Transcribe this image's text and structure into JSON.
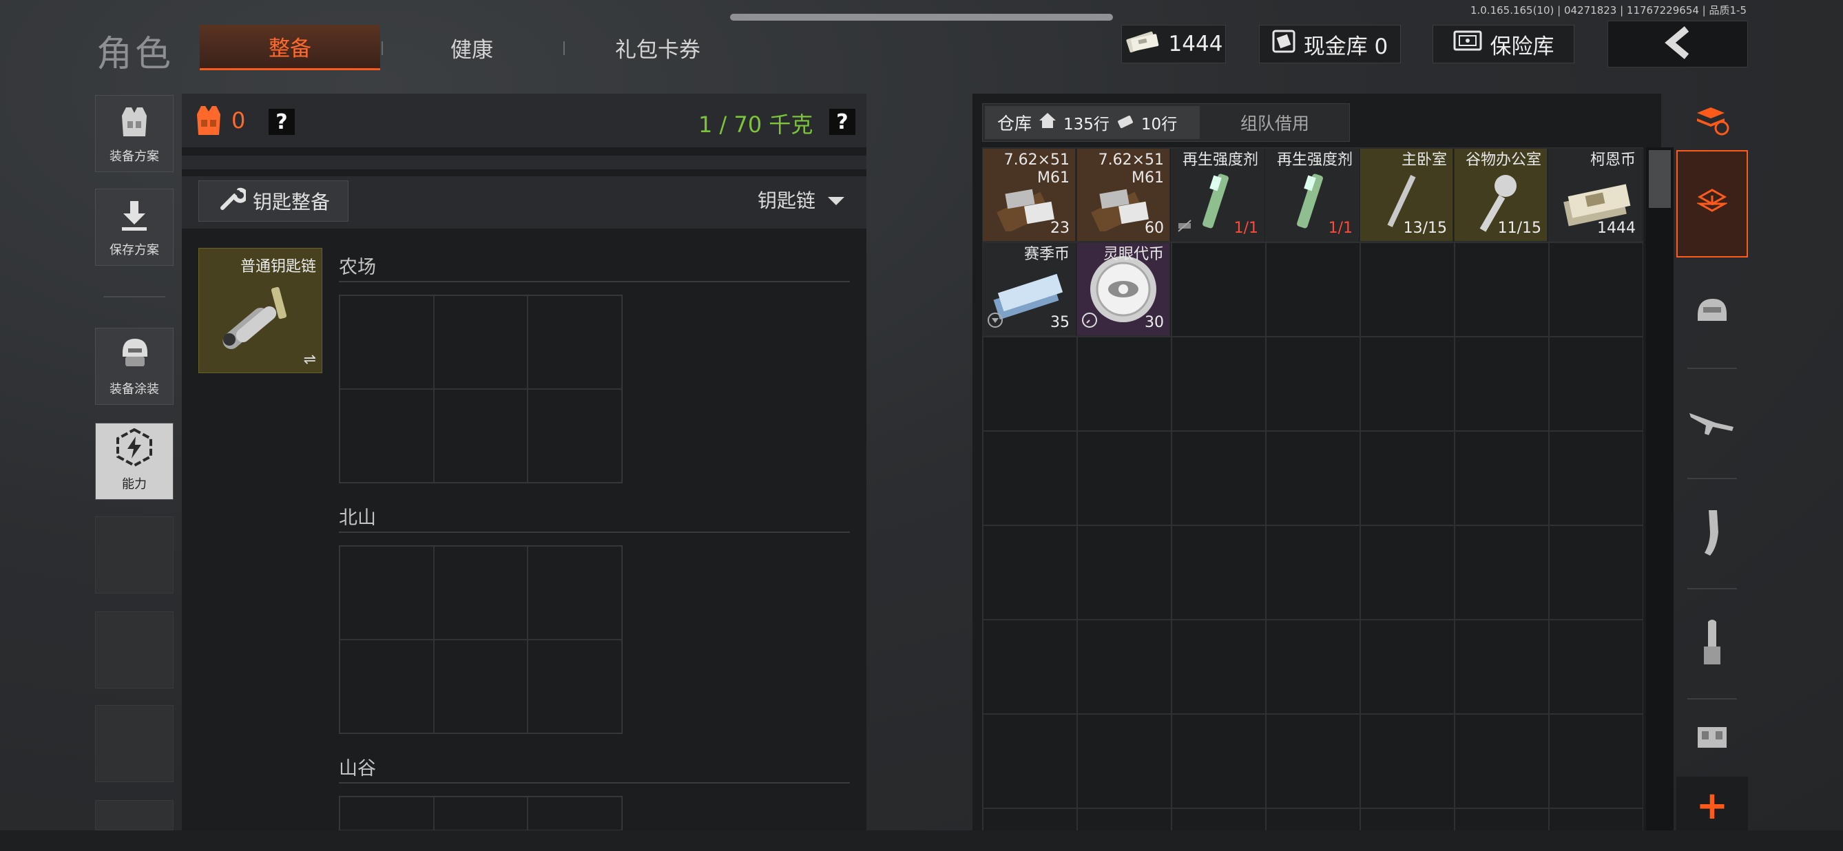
{
  "version_info": "1.0.165.165(10) | 04271823 | 11767229654 | 品质1-5",
  "header": {
    "page_title": "角色",
    "tabs": [
      "整备",
      "健康",
      "礼包卡券"
    ],
    "active_tab": "整备",
    "currency_amount": "1444",
    "cash_stash_label": "现金库 0",
    "safe_label": "保险库"
  },
  "sidebar": {
    "items": [
      {
        "label": "装备方案",
        "icon": "vest-icon"
      },
      {
        "label": "保存方案",
        "icon": "download-icon"
      },
      {
        "label": "装备涂装",
        "icon": "helmet-paint-icon"
      },
      {
        "label": "能力",
        "icon": "ability-bolt-icon"
      }
    ]
  },
  "loadout": {
    "armor_value": "0",
    "help_mark": "?",
    "weight": "1 / 70 千克",
    "key_button_label": "钥匙整备",
    "dropdown_label": "钥匙链",
    "key_item_name": "普通钥匙链",
    "sections": [
      "农场",
      "北山",
      "山谷"
    ]
  },
  "stash": {
    "tab_label": "仓库",
    "rows_label": "135行",
    "extra_rows_label": "10行",
    "team_borrow_label": "组队借用",
    "items": [
      {
        "name": "7.62×51\nM61",
        "count": "23",
        "count_red": false,
        "bg": "#4a3424"
      },
      {
        "name": "7.62×51\nM61",
        "count": "60",
        "count_red": false,
        "bg": "#4a3424"
      },
      {
        "name": "再生强度剂",
        "count": "1/1",
        "count_red": true,
        "bg": "#26282a"
      },
      {
        "name": "再生强度剂",
        "count": "1/1",
        "count_red": true,
        "bg": "#26282a"
      },
      {
        "name": "主卧室",
        "count": "13/15",
        "count_red": false,
        "bg": "#433d1f"
      },
      {
        "name": "谷物办公室",
        "count": "11/15",
        "count_red": false,
        "bg": "#433d1f"
      },
      {
        "name": "柯恩币",
        "count": "1444",
        "count_red": false,
        "bg": "#26282a"
      },
      {
        "name": "赛季币",
        "count": "35",
        "count_red": false,
        "bg": "#26282a"
      },
      {
        "name": "灵眼代币",
        "count": "30",
        "count_red": false,
        "bg": "#3a2740"
      }
    ]
  },
  "right_tabs": [
    "stash-sort-icon",
    "stash-transfer-icon",
    "helmet-icon",
    "rifle-icon",
    "magazine-icon",
    "ammo-icon",
    "chest-rig-icon"
  ],
  "colors": {
    "accent": "#ff5a1a",
    "weight_green": "#7cc43a"
  }
}
